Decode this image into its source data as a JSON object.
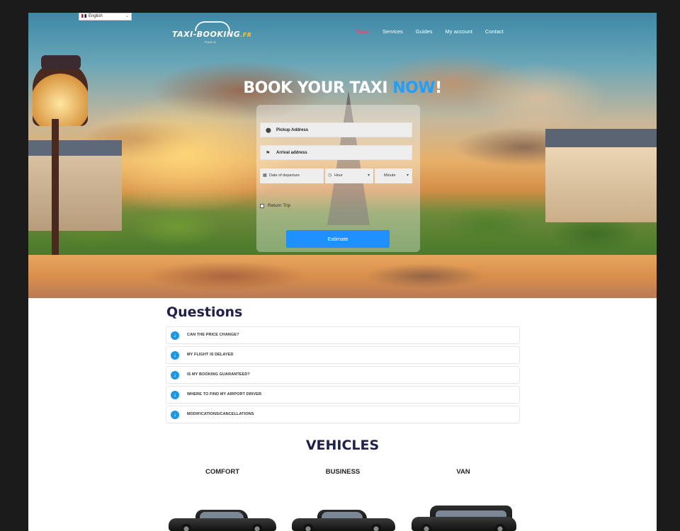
{
  "language_selector": {
    "label": "English"
  },
  "logo": {
    "main": "TAXI-BOOKING",
    "suffix": ".FR",
    "sub": "PARIS"
  },
  "nav": {
    "items": [
      "Home",
      "Services",
      "Guides",
      "My account",
      "Contact"
    ],
    "active": "Home"
  },
  "hero": {
    "headline_main": "BOOK YOUR TAXI ",
    "headline_accent": "NOW",
    "headline_end": "!"
  },
  "form": {
    "pickup_placeholder": "Pickup Address",
    "arrival_placeholder": "Arrival address",
    "date_placeholder": "Date of departure",
    "hour_placeholder": "Hour",
    "minute_placeholder": "Minute",
    "return_trip_label": "Return Trip",
    "estimate_label": "Estimate"
  },
  "questions": {
    "title": "Questions",
    "items": [
      "CAN THE PRICE CHANGE?",
      "MY FLIGHT IS DELAYED",
      "IS MY BOOKING GUARANTEED?",
      "WHERE TO FIND MY AIRPORT DRIVER",
      "MODIFICATIONS/CANCELLATIONS"
    ]
  },
  "vehicles": {
    "title": "VEHICLES",
    "items": [
      "COMFORT",
      "BUSINESS",
      "VAN"
    ]
  },
  "colors": {
    "accent": "#1e90ff",
    "nav_active": "#f0486a",
    "heading": "#20204a"
  }
}
